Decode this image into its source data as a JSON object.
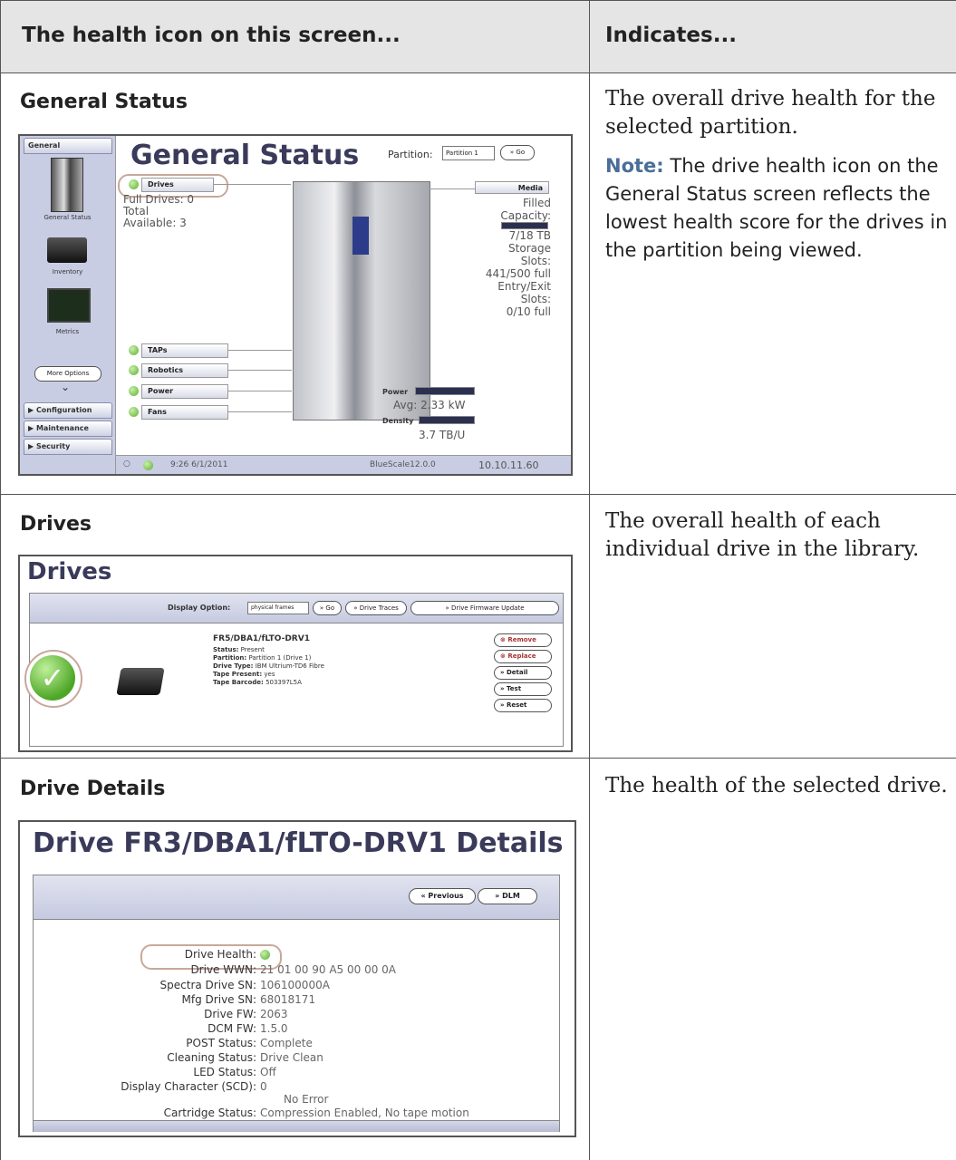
{
  "header": {
    "col1": "The health icon on this screen...",
    "col2": "Indicates..."
  },
  "rows": [
    {
      "title": "General Status",
      "description": "The overall drive health for the selected partition.",
      "note_label": "Note:",
      "note_text": "The drive health icon on the General Status screen reflects the lowest health score for the drives in the partition being viewed."
    },
    {
      "title": "Drives",
      "description": "The overall health of each individual drive in the library."
    },
    {
      "title": "Drive Details",
      "description": "The health of the selected drive."
    }
  ],
  "shot1": {
    "sidebar": {
      "general": "General",
      "general_status": "General Status",
      "inventory": "Inventory",
      "metrics": "Metrics",
      "more_options": "More Options",
      "configuration": "Configuration",
      "maintenance": "Maintenance",
      "security": "Security"
    },
    "title": "General Status",
    "partition_label": "Partition:",
    "partition_value": "Partition 1",
    "go": "» Go",
    "drives": "Drives",
    "full_drives": "Full Drives: 0",
    "total": "Total",
    "available": "Available: 3",
    "taps": "TAPs",
    "robotics": "Robotics",
    "power": "Power",
    "fans": "Fans",
    "media": "Media",
    "filled": "Filled",
    "capacity": "Capacity:",
    "capacity_value": "7/18 TB",
    "storage": "Storage",
    "slots": "Slots:",
    "slots_value": "441/500 full",
    "entry_exit": "Entry/Exit",
    "slots2": "Slots:",
    "ee_value": "0/10 full",
    "power_label": "Power",
    "avg": "Avg: 2.33 kW",
    "density_label": "Density",
    "density_value": "3.7 TB/U",
    "footer_time": "9:26 6/1/2011",
    "footer_version": "BlueScale12.0.0",
    "footer_ip": "10.10.11.60"
  },
  "shot2": {
    "title": "Drives",
    "display_option": "Display Option:",
    "display_value": "physical frames",
    "go": "» Go",
    "drive_traces": "» Drive Traces",
    "firmware_update": "» Drive Firmware Update",
    "drive_name": "FR5/DBA1/fLTO-DRV1",
    "status_label": "Status:",
    "status_value": "Present",
    "partition_label": "Partition:",
    "partition_value": "Partition 1 (Drive 1)",
    "drive_type_label": "Drive Type:",
    "drive_type_value": "IBM Ultrium-TD6 Fibre",
    "tape_present_label": "Tape Present:",
    "tape_present_value": "yes",
    "tape_barcode_label": "Tape Barcode:",
    "tape_barcode_value": "503397L5A",
    "remove": "Remove",
    "replace": "Replace",
    "detail": "» Detail",
    "test": "» Test",
    "reset": "» Reset"
  },
  "shot3": {
    "title": "Drive FR3/DBA1/fLTO-DRV1 Details",
    "previous": "« Previous",
    "dlm": "» DLM",
    "fields": [
      {
        "label": "Drive Health:",
        "value": ""
      },
      {
        "label": "Drive WWN:",
        "value": "21 01 00 90 A5 00 00 0A"
      },
      {
        "label": "Spectra Drive SN:",
        "value": "106100000A"
      },
      {
        "label": "Mfg Drive SN:",
        "value": "68018171"
      },
      {
        "label": "Drive FW:",
        "value": "2063"
      },
      {
        "label": "DCM FW:",
        "value": "1.5.0"
      },
      {
        "label": "POST Status:",
        "value": "Complete"
      },
      {
        "label": "Cleaning Status:",
        "value": "Drive Clean"
      },
      {
        "label": "LED Status:",
        "value": "Off"
      },
      {
        "label": "Display Character (SCD):",
        "value": "0"
      },
      {
        "label": "",
        "value": "No Error"
      },
      {
        "label": "Cartridge Status:",
        "value": "Compression Enabled, No tape motion"
      }
    ]
  },
  "colors": {
    "header_bg": "#e5e5e5",
    "note_label": "#4a6e98",
    "health_green": "#5fae35",
    "highlight_ring": "#c8a89a"
  }
}
